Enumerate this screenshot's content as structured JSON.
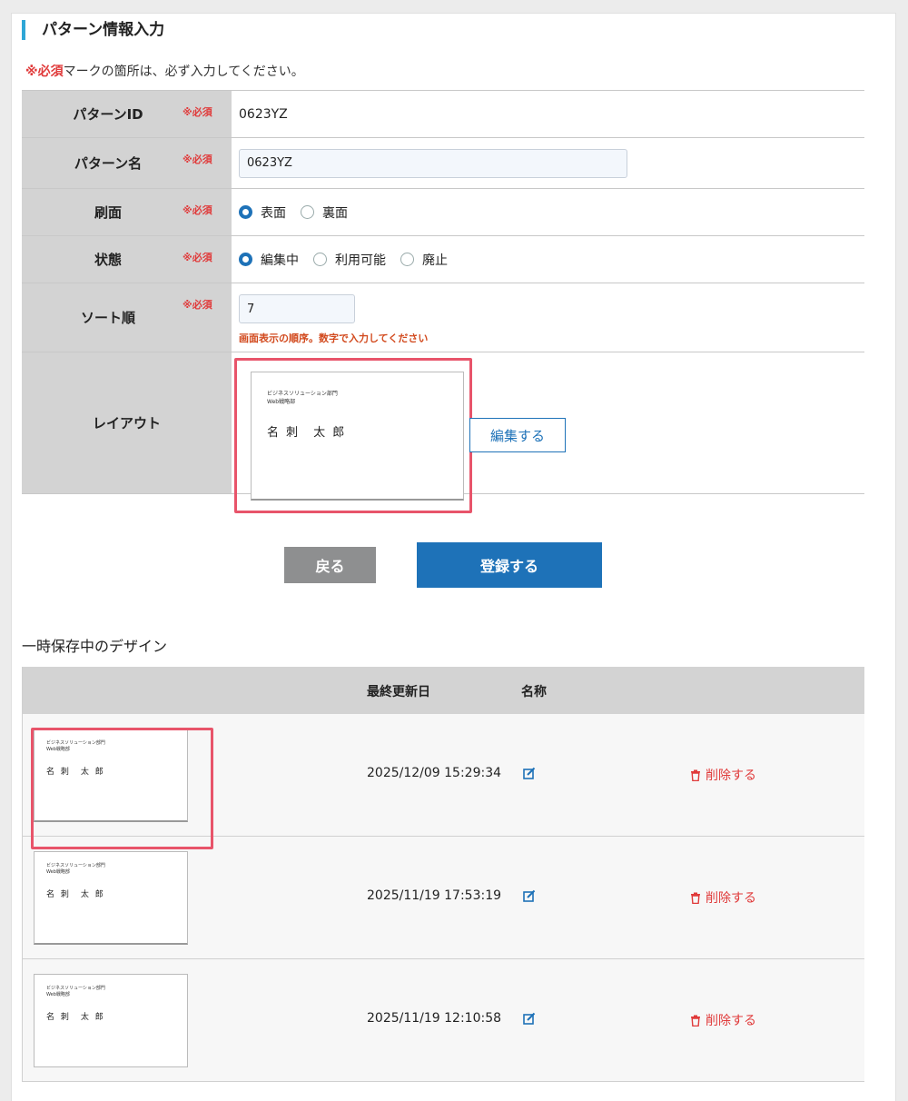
{
  "section": {
    "title": "パターン情報入力"
  },
  "note": {
    "required_mark": "※必須",
    "text": "マークの箇所は、必ず入力してください。"
  },
  "form": {
    "required_label": "※必須",
    "pattern_id": {
      "label": "パターンID",
      "value": "0623YZ"
    },
    "pattern_name": {
      "label": "パターン名",
      "value": "0623YZ"
    },
    "print_side": {
      "label": "刷面",
      "options": [
        "表面",
        "裏面"
      ],
      "selected": "表面"
    },
    "status": {
      "label": "状態",
      "options": [
        "編集中",
        "利用可能",
        "廃止"
      ],
      "selected": "編集中"
    },
    "sort_order": {
      "label": "ソート順",
      "value": "7",
      "hint": "画面表示の順序。数字で入力してください"
    },
    "layout": {
      "label": "レイアウト",
      "edit_button": "編集する"
    }
  },
  "card_preview": {
    "org": "ビジネスソリューション部門",
    "dept": "Web戦略部",
    "name": "名 刺　太 郎"
  },
  "buttons": {
    "back": "戻る",
    "submit": "登録する"
  },
  "saved": {
    "title": "一時保存中のデザイン",
    "columns": {
      "updated": "最終更新日",
      "name": "名称"
    },
    "delete_label": "削除する",
    "rows": [
      {
        "updated": "2025/12/09 15:29:34"
      },
      {
        "updated": "2025/11/19 17:53:19"
      },
      {
        "updated": "2025/11/19 12:10:58"
      }
    ]
  },
  "colors": {
    "accent": "#1e72b8",
    "required": "#e03a3a",
    "highlight": "#e8546a",
    "header_bg": "#d3d3d3"
  }
}
